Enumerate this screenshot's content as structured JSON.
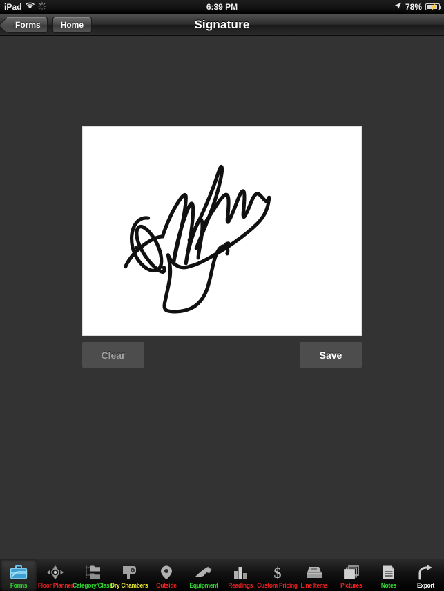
{
  "status_bar": {
    "device": "iPad",
    "wifi_icon": "wifi-icon",
    "activity_icon": "activity-spinner-icon",
    "time": "6:39 PM",
    "location_icon": "location-arrow-icon",
    "battery_percent": "78%",
    "battery_icon": "battery-charging-icon"
  },
  "nav_bar": {
    "back_button": "Forms",
    "home_button": "Home",
    "title": "Signature"
  },
  "signature": {
    "canvas_name": "signature-drawing-canvas",
    "ink_color": "#111111",
    "canvas_background": "#ffffff"
  },
  "actions": {
    "clear_label": "Clear",
    "save_label": "Save",
    "clear_color": "#a0a0a0",
    "save_color": "#ffffff"
  },
  "tab_bar": {
    "items": [
      {
        "label": "Forms",
        "icon": "briefcase-icon",
        "color": "#33dd33",
        "selected": true
      },
      {
        "label": "Floor Planner",
        "icon": "move-arrows-icon",
        "color": "#ee2222",
        "selected": false
      },
      {
        "label": "Category/Class",
        "icon": "folders-icon",
        "color": "#33dd33",
        "selected": false
      },
      {
        "label": "Dry Chambers",
        "icon": "blower-icon",
        "color": "#e8e834",
        "selected": false
      },
      {
        "label": "Outside",
        "icon": "map-pin-icon",
        "color": "#ee2222",
        "selected": false
      },
      {
        "label": "Equipment",
        "icon": "air-mover-icon",
        "color": "#33dd33",
        "selected": false
      },
      {
        "label": "Readings",
        "icon": "bar-chart-icon",
        "color": "#ee2222",
        "selected": false
      },
      {
        "label": "Custom Pricing",
        "icon": "dollar-sign-icon",
        "color": "#ee2222",
        "selected": false
      },
      {
        "label": "Line Items",
        "icon": "inbox-tray-icon",
        "color": "#ee2222",
        "selected": false
      },
      {
        "label": "Pictures",
        "icon": "photos-stack-icon",
        "color": "#ee2222",
        "selected": false
      },
      {
        "label": "Notes",
        "icon": "document-lines-icon",
        "color": "#33dd33",
        "selected": false
      },
      {
        "label": "Export",
        "icon": "share-arrow-icon",
        "color": "#ffffff",
        "selected": false
      }
    ]
  }
}
